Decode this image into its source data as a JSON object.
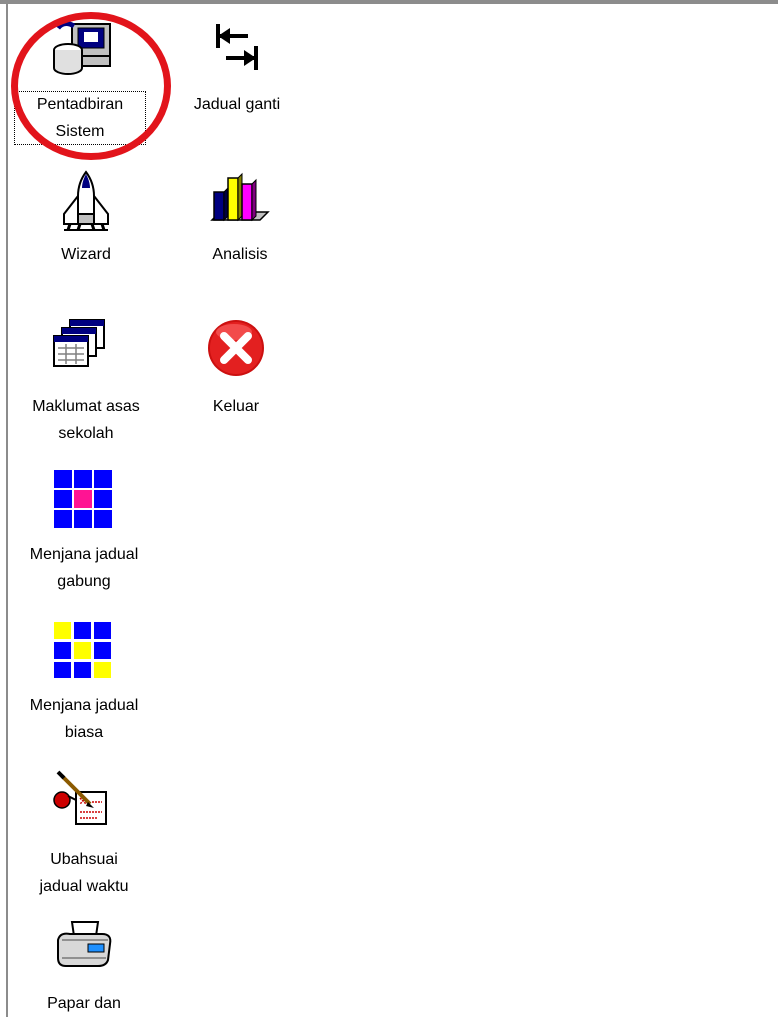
{
  "desktop": {
    "colors": {
      "highlight_ring": "#e2141b",
      "grid_blue": "#0000ff",
      "grid_pink": "#ff1493",
      "grid_yellow": "#ffff00"
    },
    "icons": [
      {
        "id": "pentadbiran_sistem",
        "label": "Pentadbiran\nSistem",
        "icon": "computer-database-icon",
        "selected": true
      },
      {
        "id": "jadual_ganti",
        "label": "Jadual ganti",
        "icon": "swap-arrows-icon"
      },
      {
        "id": "wizard",
        "label": "Wizard",
        "icon": "space-shuttle-icon"
      },
      {
        "id": "analisis",
        "label": "Analisis",
        "icon": "bar-chart-icon"
      },
      {
        "id": "maklumat_asas_sekolah",
        "label": "Maklumat asas\nsekolah",
        "icon": "stacked-windows-icon"
      },
      {
        "id": "keluar",
        "label": "Keluar",
        "icon": "exit-x-icon"
      },
      {
        "id": "menjana_jadual_gabung",
        "label": "Menjana jadual\ngabung",
        "icon": "blue-grid-icon"
      },
      {
        "id": "menjana_jadual_biasa",
        "label": "Menjana jadual\nbiasa",
        "icon": "yellow-blue-grid-icon"
      },
      {
        "id": "ubahsuai_jadual_waktu",
        "label": "Ubahsuai\njadual waktu",
        "icon": "pen-document-icon"
      },
      {
        "id": "papar_dan",
        "label": "Papar dan",
        "icon": "printer-icon"
      }
    ]
  }
}
